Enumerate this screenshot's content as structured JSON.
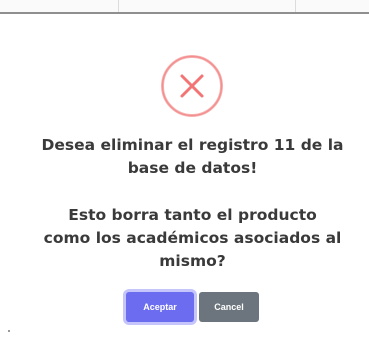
{
  "dialog": {
    "icon": "error-x-circle-icon",
    "title_lines": [
      "Desea eliminar el registro 11 de la",
      "base de datos!"
    ],
    "body_lines": [
      "Esto borra tanto el producto",
      "como los académicos asociados al",
      "mismo?"
    ],
    "confirm_label": "Aceptar",
    "cancel_label": "Cancel"
  },
  "colors": {
    "error": "#f27474",
    "error_ring": "#f7b7b7",
    "confirm": "#6c6cf0",
    "confirm_focus": "#c5c5fb",
    "cancel": "#6c757d",
    "text": "#3a3a3a"
  }
}
